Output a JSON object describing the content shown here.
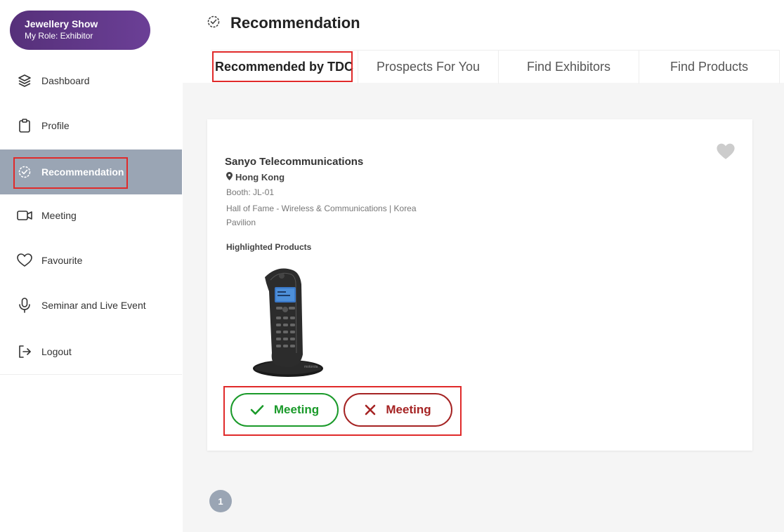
{
  "show": {
    "name": "Jewellery Show",
    "role": "My Role: Exhibitor"
  },
  "sidebar": {
    "items": [
      {
        "label": "Dashboard",
        "icon": "layers-icon"
      },
      {
        "label": "Profile",
        "icon": "clipboard-icon"
      },
      {
        "label": "Recommendation",
        "icon": "gear-badge-icon",
        "active": true
      },
      {
        "label": "Meeting",
        "icon": "video-camera-icon"
      },
      {
        "label": "Favourite",
        "icon": "heart-icon"
      },
      {
        "label": "Seminar and Live Event",
        "icon": "microphone-icon"
      },
      {
        "label": "Logout",
        "icon": "logout-icon"
      }
    ]
  },
  "page": {
    "title": "Recommendation",
    "icon": "gear-badge-icon"
  },
  "tabs": [
    {
      "label": "Recommended by TDC",
      "active": true
    },
    {
      "label": "Prospects For You"
    },
    {
      "label": "Find Exhibitors"
    },
    {
      "label": "Find Products"
    }
  ],
  "card": {
    "company": "Sanyo Telecommunications",
    "location": "Hong Kong",
    "booth": "Booth: JL-01",
    "hall": "Hall of Fame - Wireless & Communications | Korea Pavilion",
    "highlighted_title": "Highlighted Products",
    "product_brand": "motorola",
    "accept_label": "Meeting",
    "decline_label": "Meeting"
  },
  "pagination": {
    "current": "1"
  },
  "colors": {
    "brand_purple": "#5a3380",
    "active_nav": "#9aa5b4",
    "highlight": "#e02a2a",
    "accept": "#1a9a2a",
    "decline": "#a52323"
  }
}
